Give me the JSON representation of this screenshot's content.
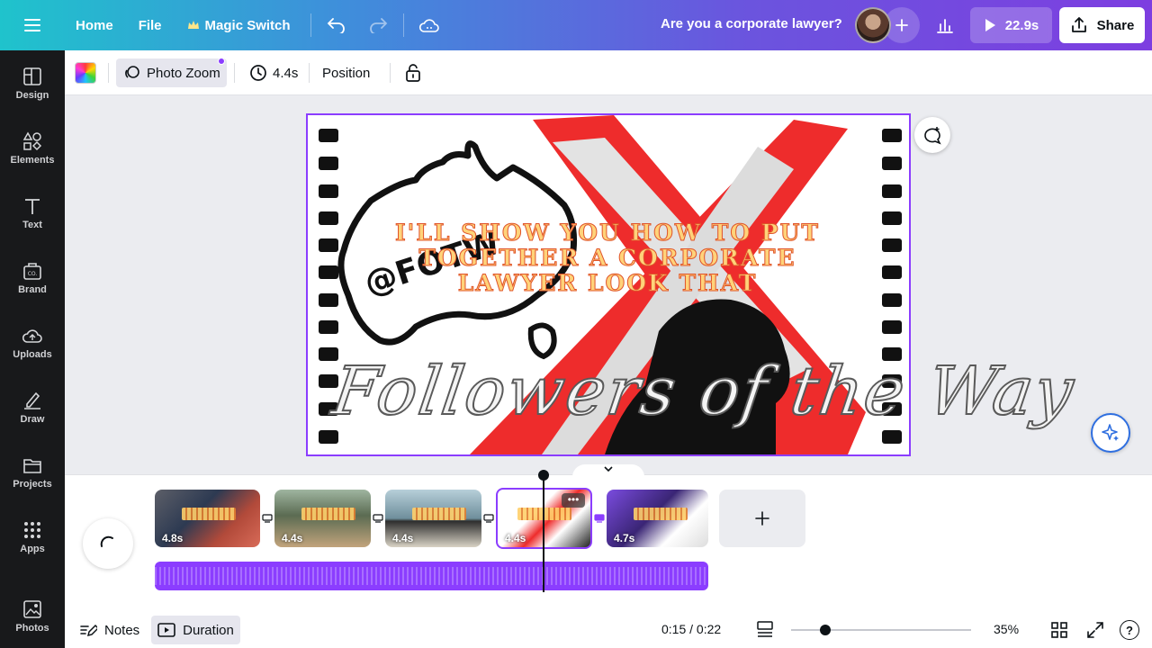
{
  "topbar": {
    "home": "Home",
    "file": "File",
    "magic_switch": "Magic Switch",
    "title": "Are you a corporate lawyer?",
    "play_duration": "22.9s",
    "share": "Share"
  },
  "sidebar": {
    "items": [
      {
        "label": "Design",
        "icon": "design-icon"
      },
      {
        "label": "Elements",
        "icon": "elements-icon"
      },
      {
        "label": "Text",
        "icon": "text-icon"
      },
      {
        "label": "Brand",
        "icon": "brand-icon"
      },
      {
        "label": "Uploads",
        "icon": "uploads-icon"
      },
      {
        "label": "Draw",
        "icon": "draw-icon"
      },
      {
        "label": "Projects",
        "icon": "projects-icon"
      },
      {
        "label": "Apps",
        "icon": "apps-icon"
      },
      {
        "label": "Photos",
        "icon": "photos-icon"
      }
    ]
  },
  "toolbar": {
    "photo_zoom": "Photo Zoom",
    "duration": "4.4s",
    "position": "Position"
  },
  "canvas": {
    "caption_lines": [
      "I'LL SHOW YOU HOW TO PUT",
      "TOGETHER A CORPORATE",
      "LAWYER LOOK THAT"
    ],
    "handle": "@FOTW",
    "script_title": "Followers of the Way"
  },
  "timeline": {
    "clips": [
      {
        "duration": "4.8s"
      },
      {
        "duration": "4.4s"
      },
      {
        "duration": "4.4s"
      },
      {
        "duration": "4.4s",
        "selected": true
      },
      {
        "duration": "4.7s"
      }
    ]
  },
  "bottombar": {
    "notes": "Notes",
    "duration": "Duration",
    "time": "0:15 / 0:22",
    "zoom": "35%",
    "zoom_level": 0.35
  },
  "colors": {
    "accent": "#8b3dff",
    "sidebar_bg": "#18191b",
    "caption_fill": "#ffd37a",
    "caption_stroke": "#e0542a"
  }
}
